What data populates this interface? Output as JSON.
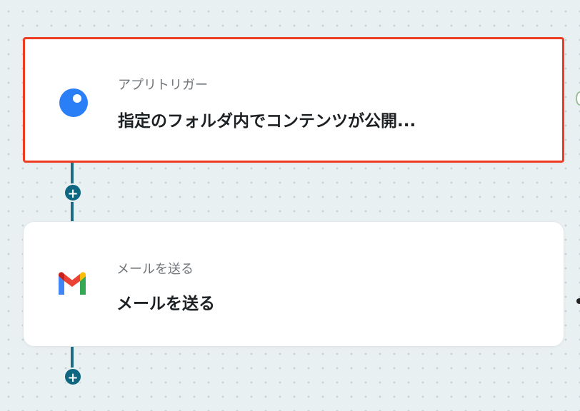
{
  "flow": {
    "steps": [
      {
        "icon": "app-trigger-icon",
        "subtitle": "アプリトリガー",
        "title": "指定のフォルダ内でコンテンツが公開...",
        "selected": true
      },
      {
        "icon": "gmail-icon",
        "subtitle": "メールを送る",
        "title": "メールを送る",
        "selected": false
      }
    ]
  },
  "colors": {
    "canvas": "#e9f0f2",
    "connector": "#1e6b82",
    "add_button": "#0f6680",
    "selection_border": "#ee3b22",
    "trigger_blue": "#2b7ff6"
  }
}
